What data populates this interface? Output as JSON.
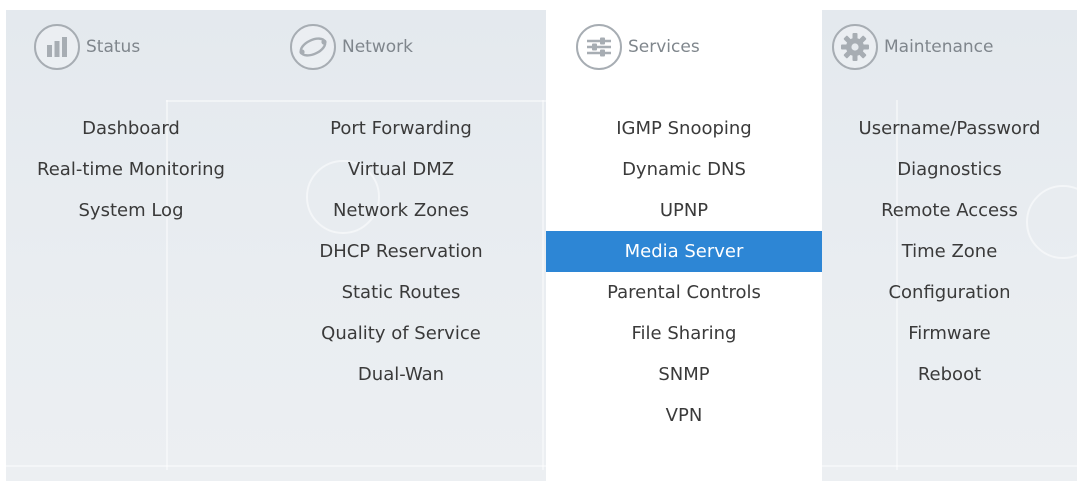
{
  "menu": {
    "columns": [
      {
        "title": "Status",
        "icon": "bar-chart-icon",
        "items": [
          "Dashboard",
          "Real-time Monitoring",
          "System Log"
        ]
      },
      {
        "title": "Network",
        "icon": "network-globe-icon",
        "items": [
          "Port Forwarding",
          "Virtual DMZ",
          "Network Zones",
          "DHCP Reservation",
          "Static Routes",
          "Quality of Service",
          "Dual-Wan"
        ]
      },
      {
        "title": "Services",
        "icon": "sliders-icon",
        "items": [
          "IGMP Snooping",
          "Dynamic DNS",
          "UPNP",
          "Media Server",
          "Parental Controls",
          "File Sharing",
          "SNMP",
          "VPN"
        ]
      },
      {
        "title": "Maintenance",
        "icon": "gear-icon",
        "items": [
          "Username/Password",
          "Diagnostics",
          "Remote Access",
          "Time Zone",
          "Configuration",
          "Firmware",
          "Reboot"
        ]
      }
    ],
    "active_column": "Services",
    "selected_item": "Media Server",
    "accent_color": "#2d86d5"
  }
}
